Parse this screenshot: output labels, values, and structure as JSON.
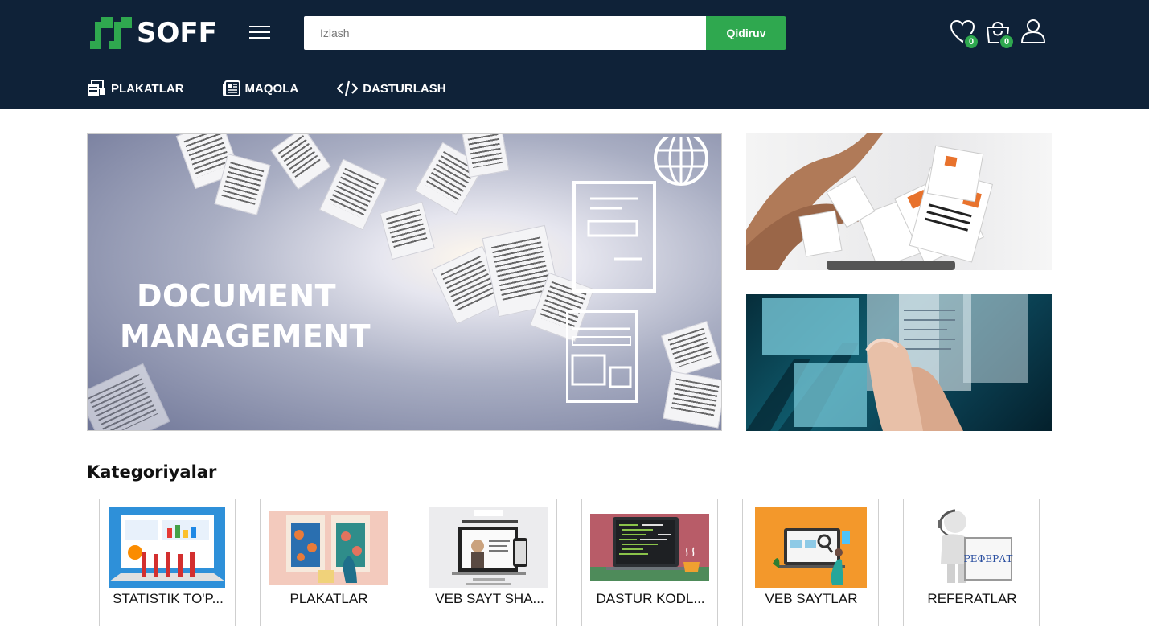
{
  "brand": {
    "name": "SOFF",
    "accent": "#2fa84f",
    "header_bg": "#0f2238"
  },
  "search": {
    "placeholder": "Izlash",
    "button_label": "Qidiruv"
  },
  "header_icons": {
    "wishlist_icon": "heart-icon",
    "wishlist_count": "0",
    "cart_icon": "shopping-bag-icon",
    "cart_count": "0",
    "account_icon": "user-icon"
  },
  "nav": {
    "items": [
      {
        "label": "PLAKATLAR",
        "icon": "poster-icon"
      },
      {
        "label": "MAQOLA",
        "icon": "newspaper-icon"
      },
      {
        "label": "DASTURLASH",
        "icon": "code-icon"
      }
    ]
  },
  "hero": {
    "main_title_line1": "DOCUMENT",
    "main_title_line2": "MANAGEMENT"
  },
  "categories": {
    "title": "Kategoriyalar",
    "items": [
      {
        "label": "STATISTIK TO'P..."
      },
      {
        "label": "PLAKATLAR"
      },
      {
        "label": "VEB SAYT SHA..."
      },
      {
        "label": "DASTUR KODL..."
      },
      {
        "label": "VEB SAYTLAR"
      },
      {
        "label": "REFERATLAR",
        "image_text": "РЕФЕРАТ"
      }
    ]
  }
}
